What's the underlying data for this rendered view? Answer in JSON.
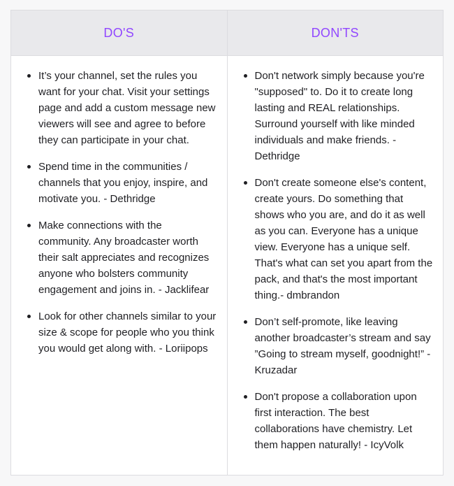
{
  "table": {
    "headers": {
      "dos": "DO'S",
      "donts": "DON'TS"
    },
    "dos": [
      "It’s your channel, set the rules you want for your chat. Visit your settings page and add a custom message new viewers will see and agree to before they can participate in your chat.",
      "Spend time in the communities / channels that you enjoy, inspire, and motivate you. - Dethridge",
      "Make connections with the community.  Any broadcaster worth their salt appreciates and recognizes anyone who bolsters community engagement and joins in. - Jacklifear",
      "Look for other channels similar to your size & scope for people who you think you would get along with. - Loriipops"
    ],
    "donts": [
      "Don't network simply because you're \"supposed\" to. Do it to create long lasting and REAL relationships. Surround yourself with like minded individuals and make friends. - Dethridge",
      "Don't create someone else's content, create yours. Do something that shows who you are, and do it as well as you can. Everyone has a unique view. Everyone has a unique self. That's what can set you apart from the pack, and that's the most important thing.- dmbrandon",
      "Don’t self-promote, like leaving another broadcaster’s stream and say ”Going to stream myself, goodnight!” - Kruzadar",
      "Don't propose a collaboration upon first interaction. The best collaborations have chemistry. Let them happen naturally! - IcyVolk"
    ]
  },
  "colors": {
    "accent": "#9147ff",
    "header_bg": "#e9e9ec",
    "border": "#dcdce0",
    "text": "#1f1f23"
  }
}
